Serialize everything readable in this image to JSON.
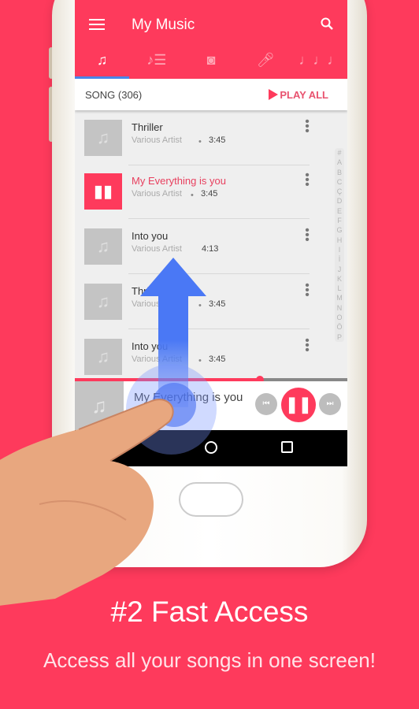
{
  "app": {
    "title": "My Music",
    "menu_icon": "hamburger-icon",
    "search_icon": "search-icon"
  },
  "tabs": [
    {
      "icon": "music-note-icon",
      "active": true
    },
    {
      "icon": "playlist-icon"
    },
    {
      "icon": "album-icon"
    },
    {
      "icon": "artist-icon"
    },
    {
      "icon": "genre-icon"
    }
  ],
  "header": {
    "count": "SONG (306)",
    "play_all": "PLAY ALL"
  },
  "songs": [
    {
      "title": "Thriller",
      "artist": "Various Artist",
      "duration": "3:45",
      "playing": false
    },
    {
      "title": "My Everything is you",
      "artist": "Various Artist",
      "duration": "3:45",
      "playing": true
    },
    {
      "title": "Into you",
      "artist": "Various Artist",
      "duration": "4:13",
      "playing": false
    },
    {
      "title": "Thriller",
      "artist": "Various Artist",
      "duration": "3:45",
      "playing": false
    },
    {
      "title": "Into you",
      "artist": "Various Artist",
      "duration": "3:45",
      "playing": false
    }
  ],
  "index_letters": [
    "#",
    "A",
    "B",
    "C",
    "Ç",
    "D",
    "E",
    "F",
    "G",
    "H",
    "I",
    "İ",
    "J",
    "K",
    "L",
    "M",
    "N",
    "O",
    "Ö",
    "P"
  ],
  "player": {
    "title": "My Everything is you",
    "progress": 0.68
  },
  "promo": {
    "headline": "#2 Fast Access",
    "subtitle": "Access all your songs in one screen!"
  },
  "colors": {
    "accent": "#fe3a5c",
    "background": "#fe3a5c",
    "tab_indicator": "#4a86e8"
  }
}
